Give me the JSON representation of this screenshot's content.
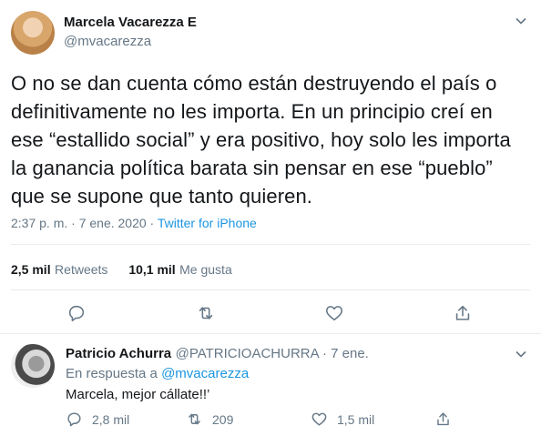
{
  "tweet": {
    "author_name": "Marcela Vacarezza E",
    "author_handle": "@mvacarezza",
    "text_lines": [
      "O no se dan cuenta cómo están destruyendo el país o",
      "definitivamente no les importa. En un principio creí en",
      "ese “estallido social” y era positivo, hoy solo les importa",
      "la ganancia política barata sin pensar en ese “pueblo”",
      "que se supone que tanto quieren."
    ],
    "time": "2:37 p. m. · 7 ene. 2020",
    "separator": " · ",
    "source": "Twitter for iPhone",
    "retweets_count": "2,5 mil",
    "retweets_label": "Retweets",
    "likes_count": "10,1 mil",
    "likes_label": "Me gusta"
  },
  "reply": {
    "author_name": "Patricio Achurra",
    "author_handle": "@PATRICIOACHURRA",
    "time": " · 7 ene.",
    "in_reply_prefix": "En respuesta a ",
    "in_reply_handle": "@mvacarezza",
    "text": "Marcela, mejor cállate!!’",
    "replies_count": "2,8 mil",
    "retweets_count": "209",
    "likes_count": "1,5 mil"
  },
  "colors": {
    "accent": "#1b95e0",
    "secondary_text": "#657786",
    "divider": "#e6ecf0"
  },
  "icons": {
    "more": "chevron-down-icon",
    "reply": "reply-icon",
    "retweet": "retweet-icon",
    "like": "heart-icon",
    "share": "share-icon"
  }
}
